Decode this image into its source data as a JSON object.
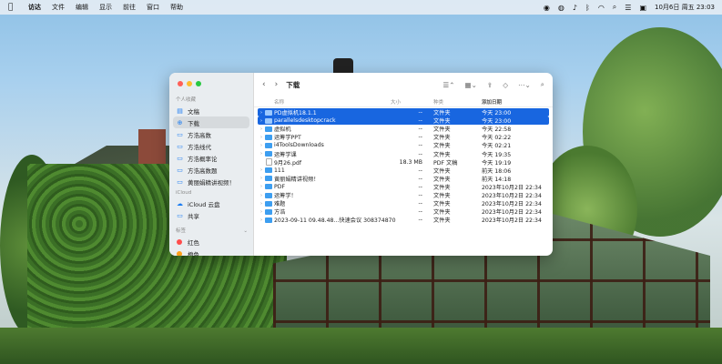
{
  "menubar": {
    "app_name": "访达",
    "items": [
      "文件",
      "编辑",
      "显示",
      "前往",
      "窗口",
      "帮助"
    ],
    "clock": "10月6日 周五 23:03"
  },
  "finder": {
    "title": "下载",
    "sidebar": {
      "favorites_header": "个人收藏",
      "favorites": [
        {
          "label": "文稿",
          "icon": "document-icon"
        },
        {
          "label": "下载",
          "icon": "download-icon"
        },
        {
          "label": "方浩高数",
          "icon": "folder-icon"
        },
        {
          "label": "方浩线代",
          "icon": "folder-icon"
        },
        {
          "label": "方浩概率论",
          "icon": "folder-icon"
        },
        {
          "label": "方浩高数题",
          "icon": "folder-icon"
        },
        {
          "label": "黄丽娟精讲视频！",
          "icon": "folder-icon"
        }
      ],
      "icloud_header": "iCloud",
      "icloud": [
        {
          "label": "iCloud 云盘",
          "icon": "cloud-icon"
        },
        {
          "label": "共享",
          "icon": "shared-folder-icon"
        }
      ],
      "tags_header": "标签",
      "tags": [
        {
          "label": "红色",
          "color": "#ff4d4d"
        },
        {
          "label": "橙色",
          "color": "#ff9f1a"
        }
      ]
    },
    "columns": {
      "name": "名称",
      "size": "大小",
      "kind": "种类",
      "date": "添加日期"
    },
    "rows": [
      {
        "name": "PD虚拟机18.1.1",
        "size": "--",
        "kind": "文件夹",
        "date": "今天 23:00",
        "selected": true,
        "folder": true,
        "expandable": true
      },
      {
        "name": "parallelsdesktopcrack",
        "size": "--",
        "kind": "文件夹",
        "date": "今天 23:00",
        "selected": true,
        "folder": true,
        "expandable": true
      },
      {
        "name": "虚拟机",
        "size": "--",
        "kind": "文件夹",
        "date": "今天 22:58",
        "folder": true,
        "expandable": true
      },
      {
        "name": "运筹学PPT",
        "size": "--",
        "kind": "文件夹",
        "date": "今天 02:22",
        "folder": true,
        "expandable": true
      },
      {
        "name": "i4ToolsDownloads",
        "size": "--",
        "kind": "文件夹",
        "date": "今天 02:21",
        "folder": true,
        "expandable": true
      },
      {
        "name": "运筹学课",
        "size": "--",
        "kind": "文件夹",
        "date": "今天 19:35",
        "folder": true,
        "expandable": true
      },
      {
        "name": "9月26.pdf",
        "size": "18.3 MB",
        "kind": "PDF 文稿",
        "date": "今天 19:19",
        "folder": false
      },
      {
        "name": "111",
        "size": "--",
        "kind": "文件夹",
        "date": "前天 18:06",
        "folder": true,
        "expandable": true
      },
      {
        "name": "黄丽娟精讲视频！",
        "size": "--",
        "kind": "文件夹",
        "date": "前天 14:18",
        "folder": true,
        "expandable": true
      },
      {
        "name": "PDF",
        "size": "--",
        "kind": "文件夹",
        "date": "2023年10月2日 22:34",
        "folder": true,
        "expandable": true
      },
      {
        "name": "运筹学！",
        "size": "--",
        "kind": "文件夹",
        "date": "2023年10月2日 22:34",
        "folder": true,
        "expandable": true
      },
      {
        "name": "难题",
        "size": "--",
        "kind": "文件夹",
        "date": "2023年10月2日 22:34",
        "folder": true,
        "expandable": true
      },
      {
        "name": "方浩",
        "size": "--",
        "kind": "文件夹",
        "date": "2023年10月2日 22:34",
        "folder": true,
        "expandable": true
      },
      {
        "name": "2023-09-11 09.48.48...快速会议 308374870",
        "size": "--",
        "kind": "文件夹",
        "date": "2023年10月2日 22:34",
        "folder": true,
        "expandable": true
      }
    ]
  }
}
